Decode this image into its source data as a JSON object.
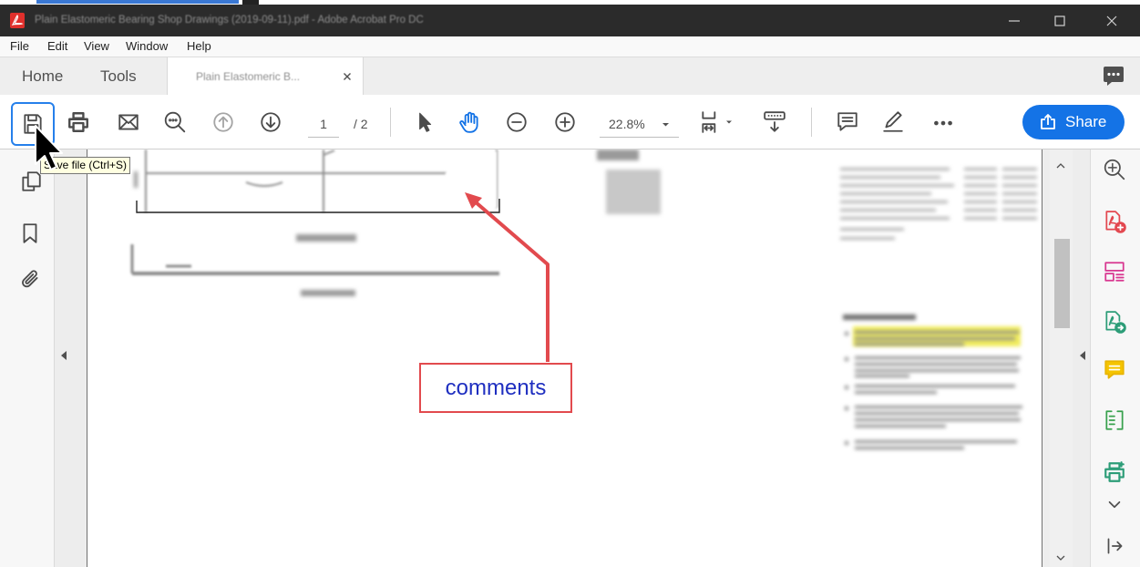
{
  "window": {
    "title": "Plain Elastomeric Bearing Shop Drawings (2019-09-11).pdf - Adobe Acrobat Pro DC"
  },
  "menu": [
    "File",
    "Edit",
    "View",
    "Window",
    "Help"
  ],
  "tabs": {
    "home": "Home",
    "tools": "Tools",
    "document": "Plain Elastomeric B..."
  },
  "toolbar": {
    "page_current": "1",
    "page_total": "/ 2",
    "zoom": "22.8%",
    "share_label": "Share"
  },
  "tooltip": "Save file (Ctrl+S)",
  "annotation": {
    "label": "comments"
  },
  "icons": {
    "titlebar": [
      "acrobat-logo-icon",
      "minimize-icon",
      "maximize-icon",
      "close-icon"
    ],
    "tabbar": [
      "tab-close-icon",
      "comments-panel-icon"
    ],
    "toolbar": [
      "save-icon",
      "print-icon",
      "email-icon",
      "find-icon",
      "page-up-icon",
      "page-down-icon",
      "select-tool-icon",
      "hand-tool-icon",
      "zoom-out-icon",
      "zoom-in-icon",
      "zoom-dropdown-icon",
      "fit-page-icon",
      "scroll-mode-icon",
      "comment-icon",
      "draw-icon",
      "more-icon",
      "share-icon"
    ],
    "left_nav": [
      "page-thumbnails-icon",
      "bookmarks-icon",
      "attachments-icon",
      "collapse-left-icon"
    ],
    "right_pane": [
      "enhance-scans-icon",
      "create-pdf-icon",
      "organize-pages-icon",
      "export-pdf-icon",
      "comment-tool-icon",
      "compare-files-icon",
      "print-production-icon",
      "more-tools-icon",
      "collapse-right-pane-icon"
    ]
  },
  "colors": {
    "accent": "#1473e6",
    "selection_border": "#2680eb",
    "title_bar": "#2b2b2b",
    "annotation_red": "#e24a4e",
    "annotation_text": "#1f2fc0",
    "tooltip_bg": "#ffffe1"
  }
}
